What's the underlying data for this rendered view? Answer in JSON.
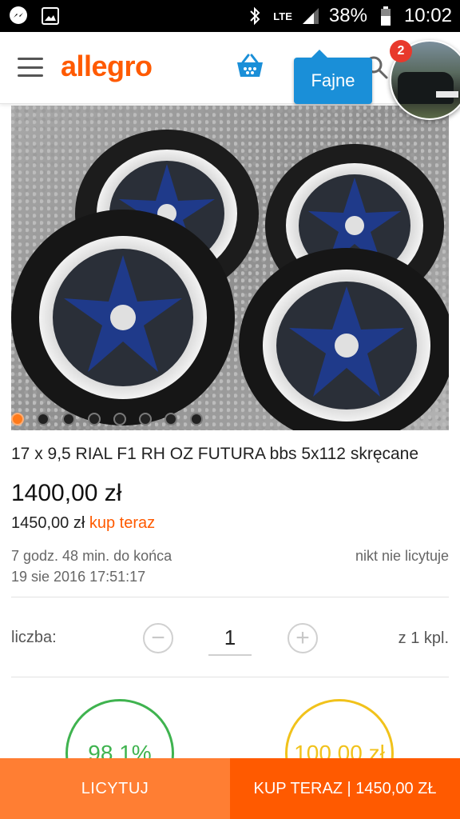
{
  "status_bar": {
    "left_icons": [
      "messenger-icon",
      "gallery-icon"
    ],
    "network": "LTE",
    "battery": "38%",
    "time": "10:02"
  },
  "appbar": {
    "logo": "allegro",
    "tooltip": "Fajne",
    "notification_count": "2",
    "brand_color": "#ff5a00"
  },
  "gallery": {
    "image_count": 8,
    "active_index": 0
  },
  "listing": {
    "title": "17 x 9,5 RIAL F1 RH OZ FUTURA bbs 5x112 skręcane",
    "price": "1400,00 zł",
    "buy_now_price": "1450,00 zł",
    "buy_now_label": "kup teraz",
    "time_left": "7 godz. 48 min. do końca",
    "end_date": "19 sie 2016 17:51:17",
    "bids_status": "nikt nie licytuje"
  },
  "quantity": {
    "label": "liczba:",
    "value": "1",
    "of_label": "z 1 kpl."
  },
  "ratings": {
    "positive": "98,1%",
    "other": "100,00 zł"
  },
  "actions": {
    "bid_label": "LICYTUJ",
    "buy_label": "KUP TERAZ | 1450,00 ZŁ"
  }
}
